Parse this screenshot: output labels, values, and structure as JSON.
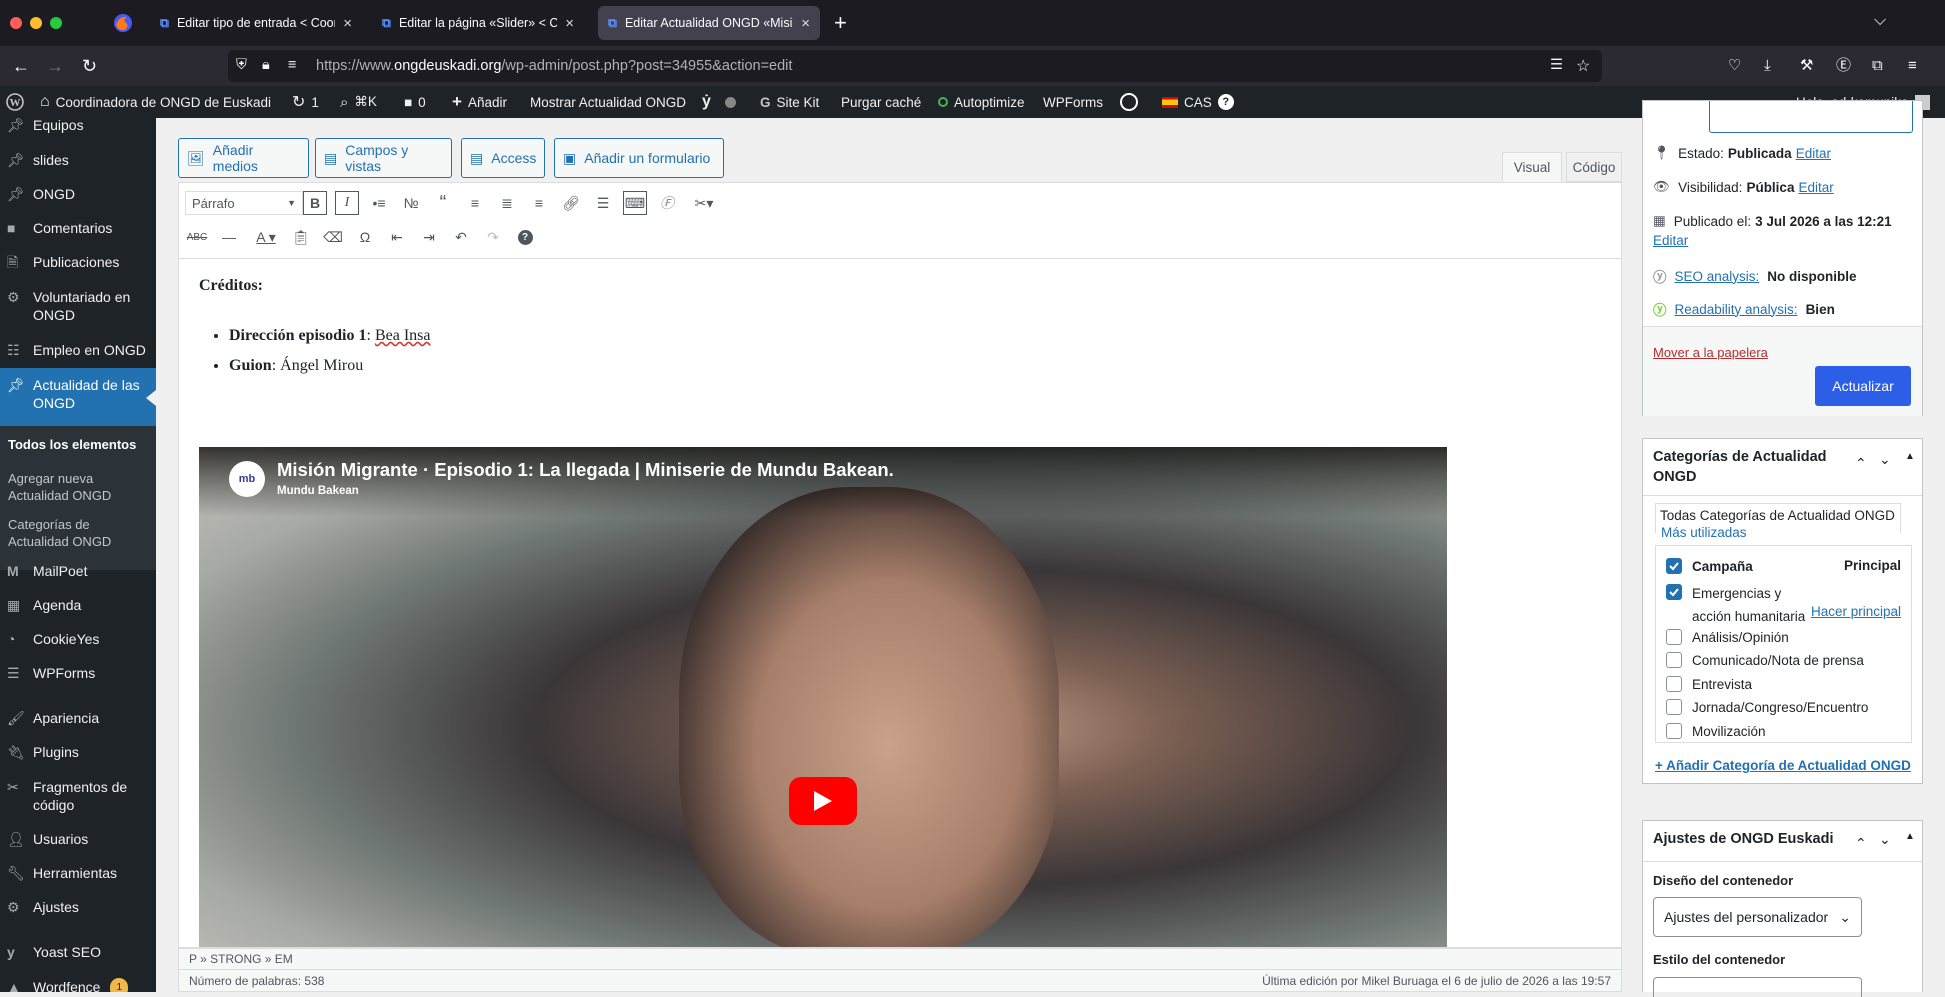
{
  "browser": {
    "tabs": [
      {
        "title": "Editar tipo de entrada < Coordin"
      },
      {
        "title": "Editar la página «Slider» < Coo"
      },
      {
        "title": "Editar Actualidad ONGD «Misión"
      }
    ],
    "new_tab": "+",
    "url_domain": "ongdeuskadi.org",
    "url_prefix": "https://www.",
    "url_suffix": "/wp-admin/post.php?post=34955&action=edit"
  },
  "adminbar": {
    "site_name": "Coordinadora de ONGD de Euskadi",
    "updates": "1",
    "search_shortcut": "⌘K",
    "comments": "0",
    "add_new": "Añadir",
    "view_post": "Mostrar Actualidad ONGD",
    "site_kit": "Site Kit",
    "purge_cache": "Purgar caché",
    "autoptimize": "Autoptimize",
    "wpforms": "WPForms",
    "language": "CAS",
    "greeting": "Hola, ad-komunika"
  },
  "sidebar": {
    "items": [
      {
        "label": "Equipos",
        "icon": "pin-icon"
      },
      {
        "label": "slides",
        "icon": "pin-icon"
      },
      {
        "label": "ONGD",
        "icon": "pin-icon"
      },
      {
        "label": "Comentarios",
        "icon": "comment-icon"
      },
      {
        "label": "Publicaciones",
        "icon": "document-icon"
      },
      {
        "label": "Voluntariado en ONGD",
        "icon": "gear-icon"
      },
      {
        "label": "Empleo en ONGD",
        "icon": "network-icon"
      },
      {
        "label": "Actualidad de las ONGD",
        "icon": "pin-icon"
      }
    ],
    "submenu": [
      {
        "label": "Todos los elementos"
      },
      {
        "label": "Agregar nueva Actualidad ONGD"
      },
      {
        "label": "Categorías de Actualidad ONGD"
      }
    ],
    "items_after": [
      {
        "label": "MailPoet",
        "icon": "mailpoet-icon"
      },
      {
        "label": "Agenda",
        "icon": "calendar-icon"
      },
      {
        "label": "CookieYes",
        "icon": "cookie-icon"
      },
      {
        "label": "WPForms",
        "icon": "form-icon"
      },
      {
        "label": "Apariencia",
        "icon": "brush-icon"
      },
      {
        "label": "Plugins",
        "icon": "plugin-icon"
      },
      {
        "label": "Fragmentos de código",
        "icon": "scissors-icon"
      },
      {
        "label": "Usuarios",
        "icon": "user-icon"
      },
      {
        "label": "Herramientas",
        "icon": "wrench-icon"
      },
      {
        "label": "Ajustes",
        "icon": "settings-icon"
      },
      {
        "label": "Yoast SEO",
        "icon": "yoast-icon"
      },
      {
        "label": "Wordfence",
        "icon": "wordfence-icon",
        "badge": "1"
      }
    ]
  },
  "editor": {
    "buttons": {
      "add_media": "Añadir medios",
      "fields_views": "Campos y vistas",
      "access": "Access",
      "add_form": "Añadir un formulario"
    },
    "tabs": {
      "visual": "Visual",
      "code": "Código"
    },
    "format_select": "Párrafo",
    "content": {
      "heading": "Créditos:",
      "list": [
        {
          "label": "Dirección episodio 1",
          "sep": ": ",
          "value": "Bea Insa"
        },
        {
          "label": "Guion",
          "sep": ": ",
          "value": "Ángel Mirou"
        }
      ],
      "video": {
        "title": "Misión Migrante · Episodio 1: La llegada | Miniserie de Mundu Bakean.",
        "channel": "Mundu Bakean",
        "channel_logo": "mb"
      }
    },
    "path": "P » STRONG » EM",
    "word_count": "Número de palabras: 538",
    "last_edit": "Última edición por Mikel Buruaga el 6 de julio de 2026 a las 19:57"
  },
  "publish": {
    "status_label": "Estado:",
    "status_value": "Publicada",
    "visibility_label": "Visibilidad:",
    "visibility_value": "Pública",
    "published_label": "Publicado el:",
    "published_value": "3 Jul 2026 a las 12:21",
    "edit": "Editar",
    "seo_link": "SEO analysis:",
    "seo_value": "No disponible",
    "readability_link": "Readability analysis:",
    "readability_value": "Bien",
    "trash": "Mover a la papelera",
    "update": "Actualizar"
  },
  "categories": {
    "title": "Categorías de Actualidad ONGD",
    "tab_all": "Todas Categorías de Actualidad ONGD",
    "tab_popular": "Más utilizadas",
    "primary": "Principal",
    "make_primary": "Hacer principal",
    "items": [
      {
        "label": "Campaña",
        "checked": true
      },
      {
        "label": "Emergencias y acción humanitaria",
        "checked": true
      },
      {
        "label": "Análisis/Opinión",
        "checked": false
      },
      {
        "label": "Comunicado/Nota de prensa",
        "checked": false
      },
      {
        "label": "Entrevista",
        "checked": false
      },
      {
        "label": "Jornada/Congreso/Encuentro",
        "checked": false
      },
      {
        "label": "Movilización",
        "checked": false
      }
    ],
    "add_new": "+ Añadir Categoría de Actualidad ONGD"
  },
  "settings": {
    "title": "Ajustes de ONGD Euskadi",
    "container_design_label": "Diseño del contenedor",
    "container_design_value": "Ajustes del personalizador",
    "container_style_label": "Estilo del contenedor"
  },
  "colors": {
    "wp_blue": "#2271b1",
    "admin_dark": "#1d2327",
    "youtube_red": "#ff0000",
    "update_btn": "#2c5ee8"
  }
}
